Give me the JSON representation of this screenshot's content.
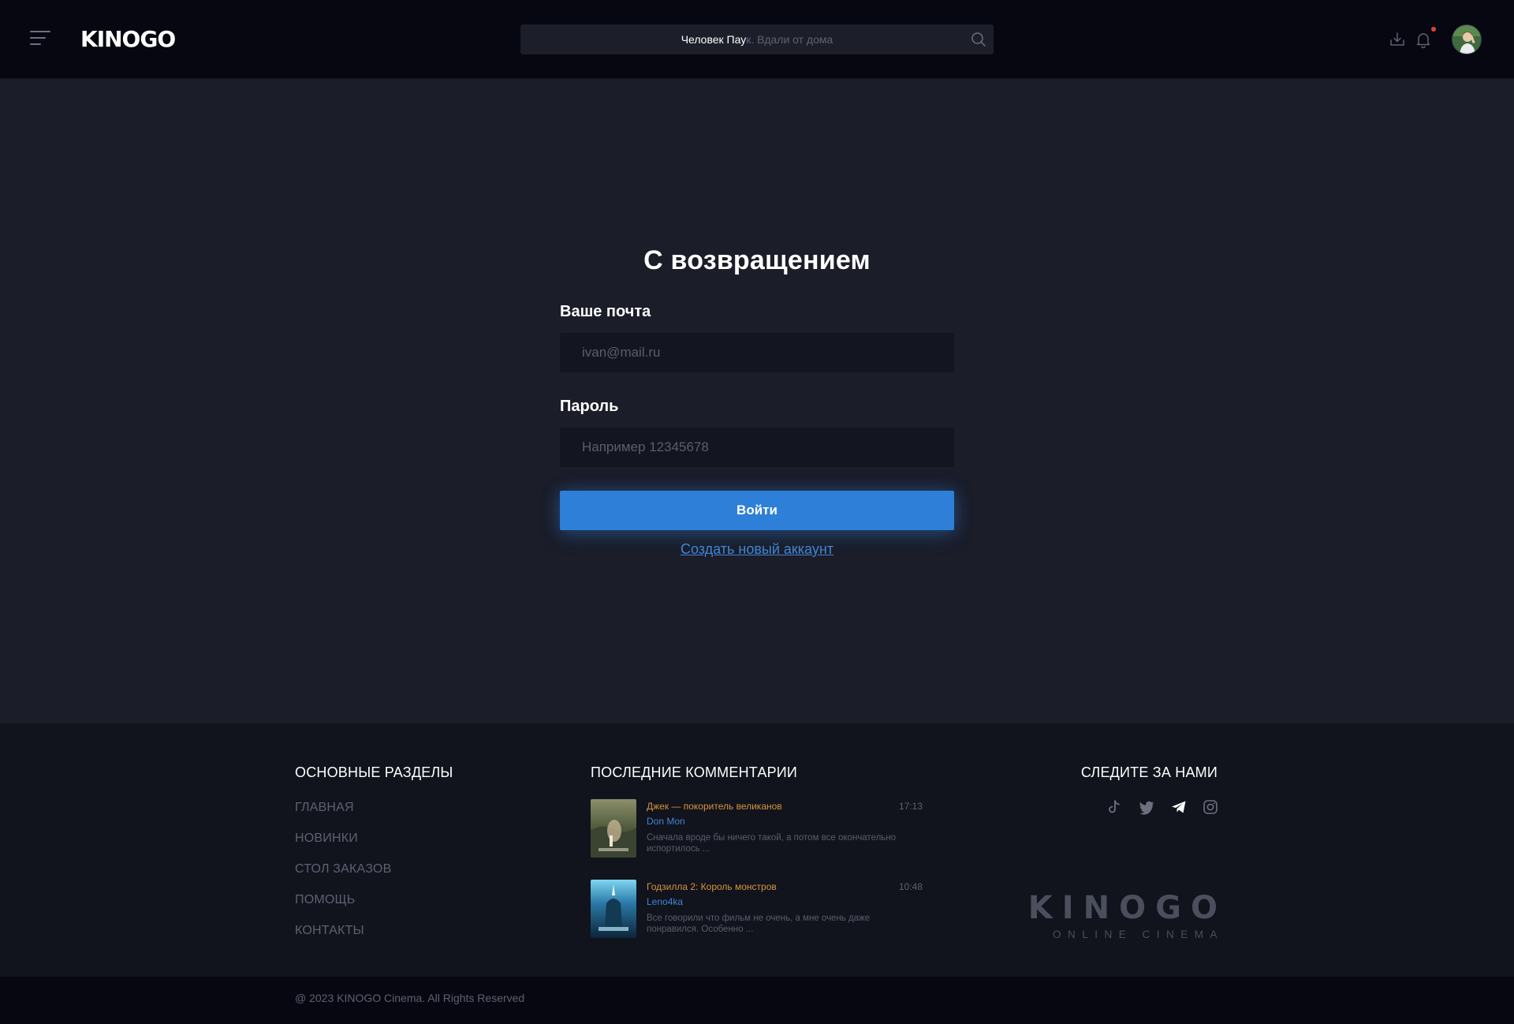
{
  "header": {
    "logo": "KINOGO",
    "search_value": "Человек Пау",
    "search_placeholder": "к. Вдали от дома"
  },
  "login": {
    "title": "С возвращением",
    "email_label": "Ваше почта",
    "email_placeholder": "ivan@mail.ru",
    "password_label": "Пароль",
    "password_placeholder": "Например 12345678",
    "submit_label": "Войти",
    "register_link": "Создать новый аккаунт"
  },
  "footer": {
    "nav_heading": "ОСНОВНЫЕ РАЗДЕЛЫ",
    "nav_items": [
      "ГЛАВНАЯ",
      "НОВИНКИ",
      "СТОЛ ЗАКАЗОВ",
      "ПОМОЩЬ",
      "КОНТАКТЫ"
    ],
    "comments_heading": "ПОСЛЕДНИЕ КОММЕНТАРИИ",
    "comments": [
      {
        "title": "Джек — покоритель великанов",
        "time": "17:13",
        "user": "Don Mon",
        "text": "Сначала вроде бы ничего такой, а потом все окончательно испортилось ..."
      },
      {
        "title": "Годзилла 2: Король монстров",
        "time": "10:48",
        "user": "Leno4ka",
        "text": "Все говорили что фильм не очень, а мне очень даже понравился. Особенно ..."
      }
    ],
    "follow_heading": "СЛЕДИТЕ ЗА НАМИ",
    "social_icons": [
      "tiktok-icon",
      "twitter-icon",
      "telegram-icon",
      "instagram-icon"
    ],
    "brand_name": "KINOGO",
    "brand_tagline": "ONLINE CINEMA",
    "copyright": "@ 2023 KINOGO Cinema. All Rights Reserved"
  },
  "colors": {
    "accent": "#2d7fd8",
    "link": "#3f86d6",
    "comment_title": "#d8953a",
    "background": "#1b1d29",
    "header_bg": "#060711",
    "footer_bg": "#11131d",
    "notification_dot": "#e0403e"
  }
}
